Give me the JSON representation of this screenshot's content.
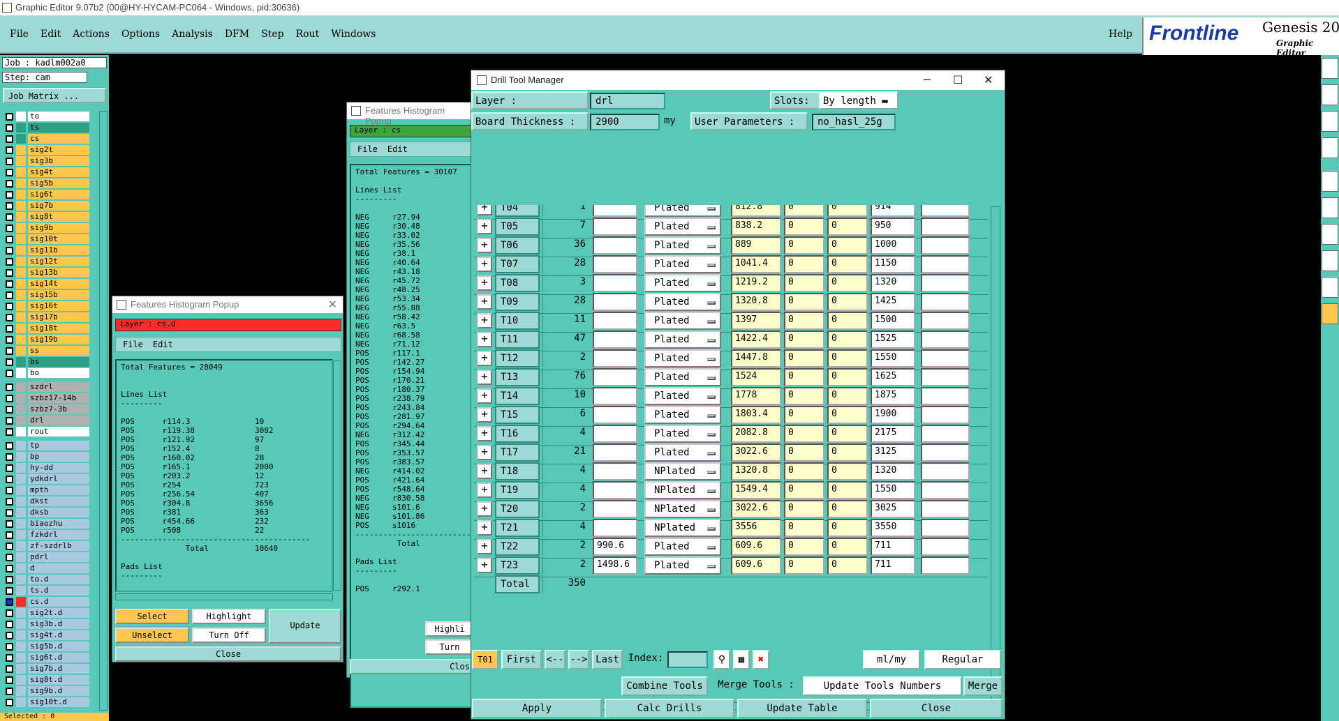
{
  "window": {
    "title": "Graphic Editor 9.07b2 (00@HY-HYCAM-PC064 - Windows, pid:30636)"
  },
  "menu": {
    "items": [
      "File",
      "Edit",
      "Actions",
      "Options",
      "Analysis",
      "DFM",
      "Step",
      "Rout",
      "Windows"
    ],
    "help": "Help"
  },
  "brand": {
    "frontline": "Frontline",
    "genesis": "Genesis 20",
    "editor": "Graphic Editor"
  },
  "job": {
    "job": "Job : kadlm002a0",
    "step": "Step: cam",
    "matrix": "Job Matrix ..."
  },
  "colors": {
    "yellow": "#ffc84c",
    "green": "#2e9e84",
    "lightblue": "#a9c9e0",
    "gray": "#b0b0b0",
    "white": "#ffffff",
    "teal": "#58c9b6"
  },
  "layers": [
    {
      "name": "to",
      "color": "white",
      "sq": "white"
    },
    {
      "name": "ts",
      "color": "green",
      "sq": "green"
    },
    {
      "name": "cs",
      "color": "yellow",
      "sq": "green"
    },
    {
      "name": "sig2t",
      "color": "yellow",
      "sq": "yellow"
    },
    {
      "name": "sig3b",
      "color": "yellow",
      "sq": "yellow"
    },
    {
      "name": "sig4t",
      "color": "yellow",
      "sq": "yellow"
    },
    {
      "name": "sig5b",
      "color": "yellow",
      "sq": "yellow"
    },
    {
      "name": "sig6t",
      "color": "yellow",
      "sq": "yellow"
    },
    {
      "name": "sig7b",
      "color": "yellow",
      "sq": "yellow"
    },
    {
      "name": "sig8t",
      "color": "yellow",
      "sq": "yellow"
    },
    {
      "name": "sig9b",
      "color": "yellow",
      "sq": "yellow"
    },
    {
      "name": "sig10t",
      "color": "yellow",
      "sq": "yellow"
    },
    {
      "name": "sig11b",
      "color": "yellow",
      "sq": "yellow"
    },
    {
      "name": "sig12t",
      "color": "yellow",
      "sq": "yellow"
    },
    {
      "name": "sig13b",
      "color": "yellow",
      "sq": "yellow"
    },
    {
      "name": "sig14t",
      "color": "yellow",
      "sq": "yellow"
    },
    {
      "name": "sig15b",
      "color": "yellow",
      "sq": "yellow"
    },
    {
      "name": "sig16t",
      "color": "yellow",
      "sq": "yellow"
    },
    {
      "name": "sig17b",
      "color": "yellow",
      "sq": "yellow"
    },
    {
      "name": "sig18t",
      "color": "yellow",
      "sq": "yellow"
    },
    {
      "name": "sig19b",
      "color": "yellow",
      "sq": "yellow"
    },
    {
      "name": "ss",
      "color": "yellow",
      "sq": "yellow"
    },
    {
      "name": "bs",
      "color": "green",
      "sq": "green"
    },
    {
      "name": "bo",
      "color": "white",
      "sq": "white"
    },
    {
      "name": "szdrl",
      "color": "gray",
      "sq": "gray"
    },
    {
      "name": "szbz17-14b",
      "color": "gray",
      "sq": "gray"
    },
    {
      "name": "szbz7-3b",
      "color": "gray",
      "sq": "gray"
    },
    {
      "name": "drl",
      "color": "gray",
      "sq": "gray"
    },
    {
      "name": "rout",
      "color": "white",
      "sq": "white"
    },
    {
      "name": "tp",
      "color": "lightblue",
      "sq": "lightblue"
    },
    {
      "name": "bp",
      "color": "lightblue",
      "sq": "lightblue"
    },
    {
      "name": "hy-dd",
      "color": "lightblue",
      "sq": "lightblue"
    },
    {
      "name": "ydkdrl",
      "color": "lightblue",
      "sq": "lightblue"
    },
    {
      "name": "mpth",
      "color": "lightblue",
      "sq": "lightblue"
    },
    {
      "name": "dkst",
      "color": "lightblue",
      "sq": "lightblue"
    },
    {
      "name": "dksb",
      "color": "lightblue",
      "sq": "lightblue"
    },
    {
      "name": "biaozhu",
      "color": "lightblue",
      "sq": "lightblue"
    },
    {
      "name": "fzkdrl",
      "color": "lightblue",
      "sq": "lightblue"
    },
    {
      "name": "zf-szdrlb",
      "color": "lightblue",
      "sq": "lightblue"
    },
    {
      "name": "pdrl",
      "color": "lightblue",
      "sq": "lightblue"
    },
    {
      "name": "d",
      "color": "lightblue",
      "sq": "lightblue"
    },
    {
      "name": "to.d",
      "color": "lightblue",
      "sq": "lightblue"
    },
    {
      "name": "ts.d",
      "color": "lightblue",
      "sq": "lightblue"
    },
    {
      "name": "cs.d",
      "color": "lightblue",
      "sq": "red"
    },
    {
      "name": "sig2t.d",
      "color": "lightblue",
      "sq": "lightblue"
    },
    {
      "name": "sig3b.d",
      "color": "lightblue",
      "sq": "lightblue"
    },
    {
      "name": "sig4t.d",
      "color": "lightblue",
      "sq": "lightblue"
    },
    {
      "name": "sig5b.d",
      "color": "lightblue",
      "sq": "lightblue"
    },
    {
      "name": "sig6t.d",
      "color": "lightblue",
      "sq": "lightblue"
    },
    {
      "name": "sig7b.d",
      "color": "lightblue",
      "sq": "lightblue"
    },
    {
      "name": "sig8t.d",
      "color": "lightblue",
      "sq": "lightblue"
    },
    {
      "name": "sig9b.d",
      "color": "lightblue",
      "sq": "lightblue"
    },
    {
      "name": "sig10t.d",
      "color": "lightblue",
      "sq": "lightblue"
    }
  ],
  "selected_label": "Selected : 0",
  "hist1": {
    "title": "Features Histogram Popup",
    "layer": "Layer : cs.d",
    "menu": [
      "File",
      "Edit"
    ],
    "text": "Total Features = 28049\n\n\nLines List\n---------\n\nPOS      r114.3              10\nPOS      r119.38             3082\nPOS      r121.92             97\nPOS      r152.4              8\nPOS      r160.02             28\nPOS      r165.1              2000\nPOS      r203.2              12\nPOS      r254                723\nPOS      r256.54             407\nPOS      r304.8              3656\nPOS      r381                363\nPOS      r454.66             232\nPOS      r508                22\n-----------------------------------------\n              Total          10640\n\nPads List\n---------",
    "buttons": {
      "select": "Select",
      "highlight": "Highlight",
      "update": "Update",
      "unselect": "Unselect",
      "turnoff": "Turn Off",
      "close": "Close"
    }
  },
  "hist2": {
    "title": "Features Histogram Popup",
    "layer": "Layer : cs",
    "menu": [
      "File",
      "Edit"
    ],
    "text": "Total Features = 30107\n\nLines List\n---------\n\nNEG     r27.94\nNEG     r30.48\nNEG     r33.02\nNEG     r35.56\nNEG     r38.1\nNEG     r40.64\nNEG     r43.18\nNEG     r45.72\nNEG     r48.25\nNEG     r53.34\nNEG     r55.88\nNEG     r58.42\nNEG     r63.5\nNEG     r68.58\nNEG     r71.12\nPOS     r117.1\nPOS     r142.27\nPOS     r154.94\nPOS     r170.21\nPOS     r180.37\nPOS     r238.79\nPOS     r243.84\nPOS     r281.97\nPOS     r294.64\nNEG     r312.42\nPOS     r345.44\nPOS     r353.57\nPOS     r383.57\nNEG     r414.02\nPOS     r421.64\nPOS     r548.64\nNEG     r830.58\nNEG     s101.6\nNEG     s101.86\nPOS     s1016\n----------------------------\n         Total\n\nPads List\n---------\n\nPOS     r292.1",
    "buttons": {
      "highlight": "Highli",
      "turn": "Turn",
      "close": "Clos"
    }
  },
  "dtm": {
    "title": "Drill Tool Manager",
    "layer_label": "Layer          :",
    "layer_value": "drl",
    "slots_label": "Slots:",
    "slots_value": "By length",
    "thickness_label": "Board Thickness :",
    "thickness_value": "2900",
    "thickness_unit": "my",
    "params_label": "User Parameters :",
    "params_value": "no_hasl_25g",
    "tools": [
      {
        "id": "T04",
        "count": "1",
        "in": "",
        "type": "Plated",
        "size": "812.8",
        "a": "0",
        "b": "0",
        "fin": "914"
      },
      {
        "id": "T05",
        "count": "7",
        "in": "",
        "type": "Plated",
        "size": "838.2",
        "a": "0",
        "b": "0",
        "fin": "950"
      },
      {
        "id": "T06",
        "count": "36",
        "in": "",
        "type": "Plated",
        "size": "889",
        "a": "0",
        "b": "0",
        "fin": "1000"
      },
      {
        "id": "T07",
        "count": "28",
        "in": "",
        "type": "Plated",
        "size": "1041.4",
        "a": "0",
        "b": "0",
        "fin": "1150"
      },
      {
        "id": "T08",
        "count": "3",
        "in": "",
        "type": "Plated",
        "size": "1219.2",
        "a": "0",
        "b": "0",
        "fin": "1320"
      },
      {
        "id": "T09",
        "count": "28",
        "in": "",
        "type": "Plated",
        "size": "1320.8",
        "a": "0",
        "b": "0",
        "fin": "1425"
      },
      {
        "id": "T10",
        "count": "11",
        "in": "",
        "type": "Plated",
        "size": "1397",
        "a": "0",
        "b": "0",
        "fin": "1500"
      },
      {
        "id": "T11",
        "count": "47",
        "in": "",
        "type": "Plated",
        "size": "1422.4",
        "a": "0",
        "b": "0",
        "fin": "1525"
      },
      {
        "id": "T12",
        "count": "2",
        "in": "",
        "type": "Plated",
        "size": "1447.8",
        "a": "0",
        "b": "0",
        "fin": "1550"
      },
      {
        "id": "T13",
        "count": "76",
        "in": "",
        "type": "Plated",
        "size": "1524",
        "a": "0",
        "b": "0",
        "fin": "1625"
      },
      {
        "id": "T14",
        "count": "10",
        "in": "",
        "type": "Plated",
        "size": "1778",
        "a": "0",
        "b": "0",
        "fin": "1875"
      },
      {
        "id": "T15",
        "count": "6",
        "in": "",
        "type": "Plated",
        "size": "1803.4",
        "a": "0",
        "b": "0",
        "fin": "1900"
      },
      {
        "id": "T16",
        "count": "4",
        "in": "",
        "type": "Plated",
        "size": "2082.8",
        "a": "0",
        "b": "0",
        "fin": "2175"
      },
      {
        "id": "T17",
        "count": "21",
        "in": "",
        "type": "Plated",
        "size": "3022.6",
        "a": "0",
        "b": "0",
        "fin": "3125"
      },
      {
        "id": "T18",
        "count": "4",
        "in": "",
        "type": "NPlated",
        "size": "1320.8",
        "a": "0",
        "b": "0",
        "fin": "1320"
      },
      {
        "id": "T19",
        "count": "4",
        "in": "",
        "type": "NPlated",
        "size": "1549.4",
        "a": "0",
        "b": "0",
        "fin": "1550"
      },
      {
        "id": "T20",
        "count": "2",
        "in": "",
        "type": "NPlated",
        "size": "3022.6",
        "a": "0",
        "b": "0",
        "fin": "3025"
      },
      {
        "id": "T21",
        "count": "4",
        "in": "",
        "type": "NPlated",
        "size": "3556",
        "a": "0",
        "b": "0",
        "fin": "3550"
      },
      {
        "id": "T22",
        "count": "2",
        "in": "990.6",
        "type": "Plated",
        "size": "609.6",
        "a": "0",
        "b": "0",
        "fin": "711"
      },
      {
        "id": "T23",
        "count": "2",
        "in": "1498.6",
        "type": "Plated",
        "size": "609.6",
        "a": "0",
        "b": "0",
        "fin": "711"
      }
    ],
    "total_label": "Total",
    "total_value": "350",
    "nav": {
      "current": "T01",
      "first": "First",
      "prev": "<--",
      "next": "-->",
      "last": "Last",
      "index_label": "Index:",
      "units": "ml/my",
      "mode": "Regular"
    },
    "actions": {
      "combine": "Combine Tools",
      "merge_label": "Merge Tools :",
      "update_numbers": "Update Tools Numbers",
      "merge": "Merge"
    },
    "bottom": {
      "apply": "Apply",
      "calc": "Calc Drills",
      "update": "Update Table",
      "close": "Close"
    }
  }
}
